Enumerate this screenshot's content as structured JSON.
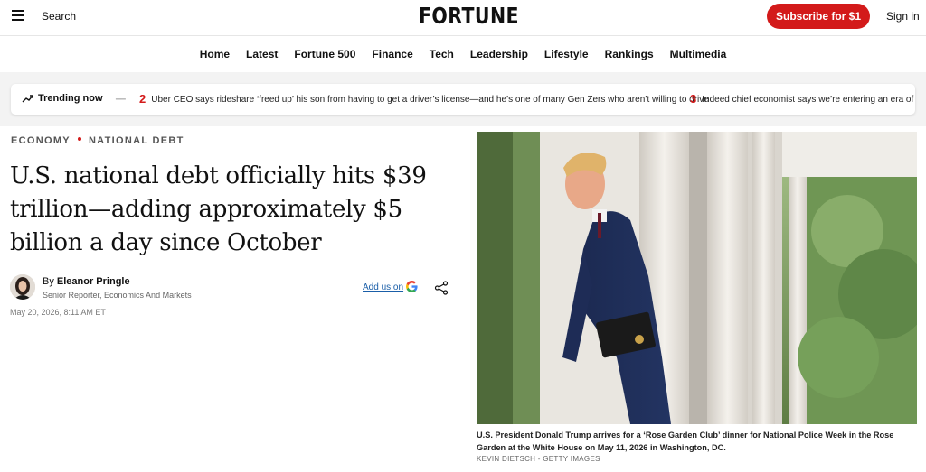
{
  "header": {
    "search_label": "Search",
    "logo_text": "FORTUNE",
    "subscribe_label": "Subscribe for $1",
    "signin_label": "Sign in",
    "accent_color": "#d31a1a"
  },
  "nav": {
    "items": [
      "Home",
      "Latest",
      "Fortune 500",
      "Finance",
      "Tech",
      "Leadership",
      "Lifestyle",
      "Rankings",
      "Multimedia"
    ]
  },
  "trending": {
    "label": "Trending now",
    "items": [
      {
        "num": "2",
        "text": "Uber CEO says rideshare ‘freed up’ his son from having to get a driver’s license—and he’s one of many Gen Zers who aren’t willing to drive"
      },
      {
        "num": "3",
        "text": "Indeed chief economist says we’re entering an era of ‘gre"
      }
    ]
  },
  "article": {
    "sections": [
      "ECONOMY",
      "NATIONAL DEBT"
    ],
    "headline": "U.S. national debt officially hits $39 trillion—adding approximately $5 billion a day since October",
    "author_prefix": "By",
    "author_name": "Eleanor Pringle",
    "author_role": "Senior Reporter, Economics And Markets",
    "date": "May 20, 2026, 8:11 AM ET",
    "add_us_label": "Add us on",
    "icons": [
      "google-icon",
      "share-icon"
    ]
  },
  "image": {
    "caption": "U.S. President Donald Trump arrives for a ‘Rose Garden Club’ dinner for National Police Week in the Rose Garden at the White House on May 11, 2026 in Washington, DC.",
    "credit": "KEVIN DIETSCH - GETTY IMAGES"
  }
}
